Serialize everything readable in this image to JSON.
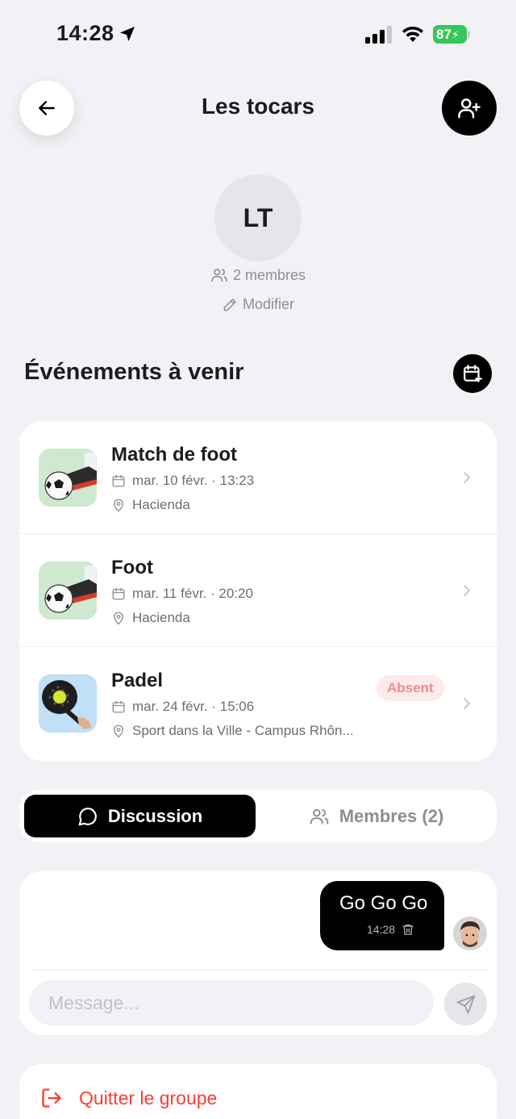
{
  "status_bar": {
    "time": "14:28",
    "battery": "87"
  },
  "header": {
    "title": "Les tocars"
  },
  "group": {
    "initials": "LT",
    "members_count": "2 membres",
    "edit_label": "Modifier"
  },
  "events": {
    "section_title": "Événements à venir",
    "items": [
      {
        "title": "Match de foot",
        "date": "mar. 10 févr. · 13:23",
        "place": "Hacienda",
        "icon": "soccer-thumbnail",
        "badge": ""
      },
      {
        "title": "Foot",
        "date": "mar. 11 févr. · 20:20",
        "place": "Hacienda",
        "icon": "soccer-thumbnail",
        "badge": ""
      },
      {
        "title": "Padel",
        "date": "mar. 24 févr. · 15:06",
        "place": "Sport dans la Ville - Campus Rhôn...",
        "icon": "padel-thumbnail",
        "badge": "Absent"
      }
    ]
  },
  "tabs": {
    "discussion": "Discussion",
    "members": "Membres (2)"
  },
  "chat": {
    "messages": [
      {
        "text": "Go Go Go",
        "time": "14:28"
      }
    ],
    "input_placeholder": "Message..."
  },
  "leave": {
    "label": "Quitter le groupe"
  },
  "colors": {
    "background": "#f2f2f6",
    "accent": "#000000",
    "danger": "#ff3b30",
    "battery": "#34c759",
    "soccer_thumb_bg": "#cfe9cf",
    "padel_thumb_bg": "#bfe0f7"
  }
}
